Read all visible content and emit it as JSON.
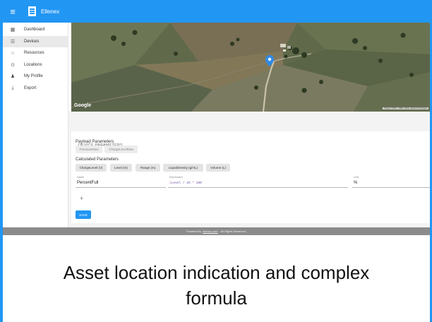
{
  "app": {
    "title": "Ellenex"
  },
  "sidebar": {
    "items": [
      {
        "label": "Dashboard",
        "icon": "dashboard-icon",
        "active": false
      },
      {
        "label": "Devices",
        "icon": "list-icon",
        "active": true
      },
      {
        "label": "Resources",
        "icon": "circle-icon",
        "active": false
      },
      {
        "label": "Locations",
        "icon": "location-target-icon",
        "active": false
      },
      {
        "label": "My Profile",
        "icon": "person-icon",
        "active": false
      },
      {
        "label": "Export",
        "icon": "download-icon",
        "active": false
      }
    ]
  },
  "map": {
    "brand": "Google",
    "attribution": "Imagery ©2019 , CNES / Airbus, Maxar Technologies"
  },
  "device_parameters": {
    "title": "DEVICE PARAMETERS",
    "payload": {
      "label": "Payload Parameters",
      "chips": [
        "PressureRaw",
        "ChargeLevelRaw"
      ]
    },
    "calculated": {
      "label": "Calculated Parameters",
      "chips": [
        "ChargeLevel (V)",
        "Level (m)",
        "Range (m)",
        "LiquidDensity (g/mL)",
        "Volume (L)"
      ]
    },
    "formula": {
      "name_label": "Name",
      "name_value": "PercentFull",
      "expression_label": "Expression",
      "expression_value": "(Level / 25 * 100",
      "unit_label": "Unit",
      "unit_value": "%"
    },
    "add_label": "+",
    "save_label": "SAVE"
  },
  "footer": {
    "prefix": "Powered by",
    "link": "ellenex.com",
    "suffix": "- All Rights Reserved."
  },
  "caption": {
    "line1": "Asset location indication and complex",
    "line2": "formula"
  },
  "colors": {
    "primary": "#2196f3",
    "map_pin": "#2f8be6",
    "footer": "#8b8b8b"
  }
}
